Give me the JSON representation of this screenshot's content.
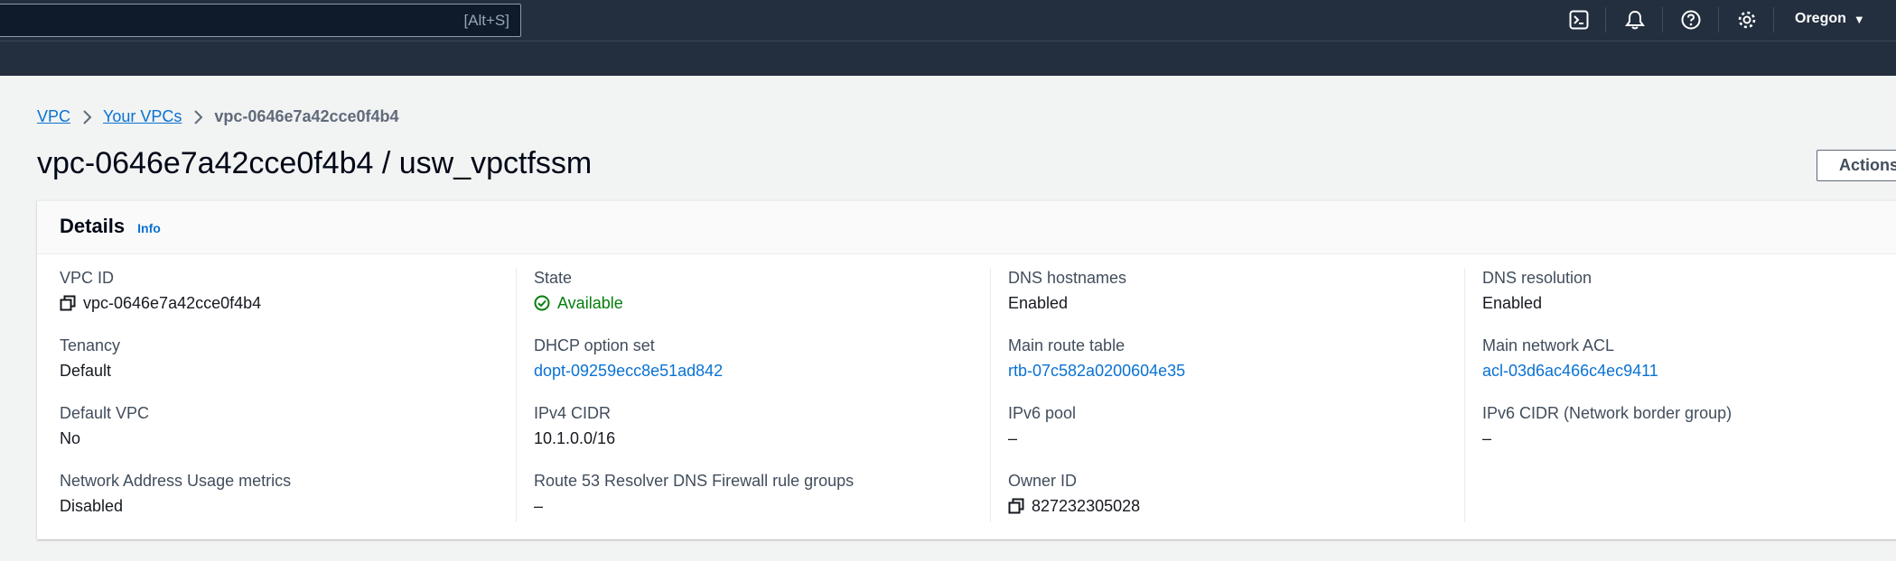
{
  "topbar": {
    "search_shortcut": "[Alt+S]",
    "icons": [
      "cloudshell-icon",
      "notifications-icon",
      "help-icon",
      "settings-icon"
    ],
    "region": "Oregon"
  },
  "breadcrumb": {
    "items": [
      "VPC",
      "Your VPCs"
    ],
    "current": "vpc-0646e7a42cce0f4b4"
  },
  "page": {
    "title": "vpc-0646e7a42cce0f4b4 / usw_vpctfssm",
    "actions_label": "Actions"
  },
  "details": {
    "title": "Details",
    "info_label": "Info",
    "fields": {
      "vpc_id": {
        "label": "VPC ID",
        "value": "vpc-0646e7a42cce0f4b4"
      },
      "tenancy": {
        "label": "Tenancy",
        "value": "Default"
      },
      "default_vpc": {
        "label": "Default VPC",
        "value": "No"
      },
      "nau_metrics": {
        "label": "Network Address Usage metrics",
        "value": "Disabled"
      },
      "state": {
        "label": "State",
        "value": "Available"
      },
      "dhcp": {
        "label": "DHCP option set",
        "value": "dopt-09259ecc8e51ad842"
      },
      "ipv4_cidr": {
        "label": "IPv4 CIDR",
        "value": "10.1.0.0/16"
      },
      "r53_firewall": {
        "label": "Route 53 Resolver DNS Firewall rule groups",
        "value": "–"
      },
      "dns_hostnames": {
        "label": "DNS hostnames",
        "value": "Enabled"
      },
      "main_route_table": {
        "label": "Main route table",
        "value": "rtb-07c582a0200604e35"
      },
      "ipv6_pool": {
        "label": "IPv6 pool",
        "value": "–"
      },
      "owner_id": {
        "label": "Owner ID",
        "value": "827232305028"
      },
      "dns_resolution": {
        "label": "DNS resolution",
        "value": "Enabled"
      },
      "main_nacl": {
        "label": "Main network ACL",
        "value": "acl-03d6ac466c4ec9411"
      },
      "ipv6_cidr": {
        "label": "IPv6 CIDR (Network border group)",
        "value": "–"
      }
    }
  },
  "colors": {
    "topbar_bg": "#232f3e",
    "link": "#0972d3",
    "success": "#037f0c",
    "page_bg": "#f2f3f3"
  }
}
